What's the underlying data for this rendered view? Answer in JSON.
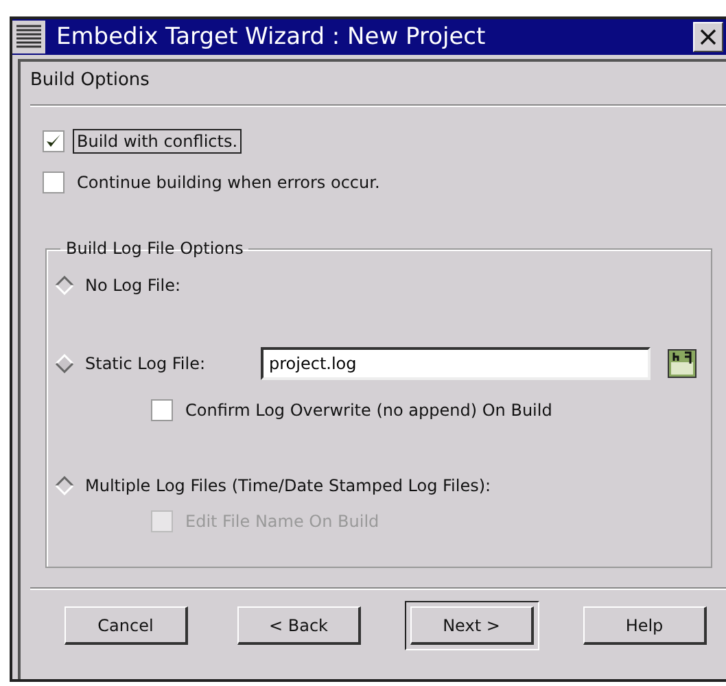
{
  "window": {
    "title": "Embedix Target Wizard : New Project"
  },
  "page_title": "Build Options",
  "checkboxes": [
    {
      "label": "Build with conflicts.",
      "checked": true,
      "focused": true
    },
    {
      "label": "Continue building when errors occur.",
      "checked": false,
      "focused": false
    }
  ],
  "log_group": {
    "title": "Build Log File Options",
    "options": [
      {
        "label": "No Log File:",
        "selected": false
      },
      {
        "label": "Static Log File:",
        "selected": true,
        "field": {
          "value": "project.log"
        },
        "checkbox": {
          "label": "Confirm Log Overwrite (no append) On Build",
          "checked": false,
          "disabled": false
        }
      },
      {
        "label": "Multiple Log Files (Time/Date Stamped Log Files):",
        "selected": false,
        "checkbox": {
          "label": "Edit File Name On Build",
          "checked": false,
          "disabled": true
        }
      }
    ]
  },
  "buttons": [
    {
      "label": "Cancel",
      "default": false
    },
    {
      "label": "< Back",
      "default": false
    },
    {
      "label": "Next >",
      "default": true
    },
    {
      "label": "Help",
      "default": false
    }
  ]
}
